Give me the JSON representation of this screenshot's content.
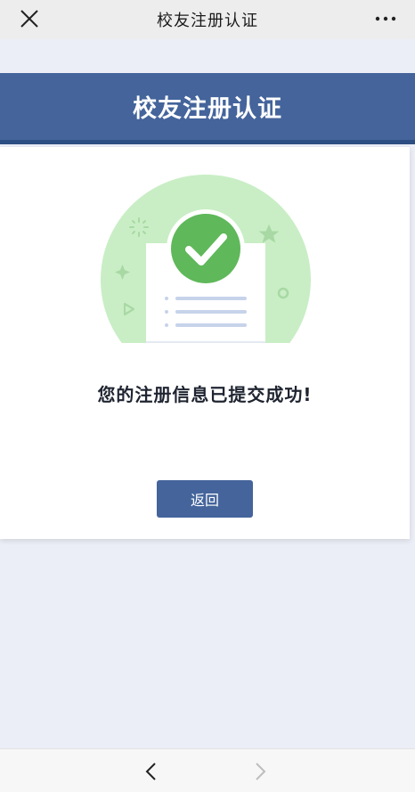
{
  "topbar": {
    "title": "校友注册认证",
    "close_icon": "close-icon",
    "more_icon": "more-dots-icon"
  },
  "header": {
    "title": "校友注册认证"
  },
  "result": {
    "message": "您的注册信息已提交成功!",
    "illustration": "success-check-document-illustration",
    "return_label": "返回"
  },
  "bottombar": {
    "back_icon": "chevron-left-icon",
    "forward_icon": "chevron-right-icon"
  },
  "colors": {
    "brand_blue": "#44649b",
    "brand_blue_dark": "#2d4e82",
    "success_green": "#5fb85a",
    "light_green": "#c9eec5",
    "page_bg": "#eceef7"
  }
}
